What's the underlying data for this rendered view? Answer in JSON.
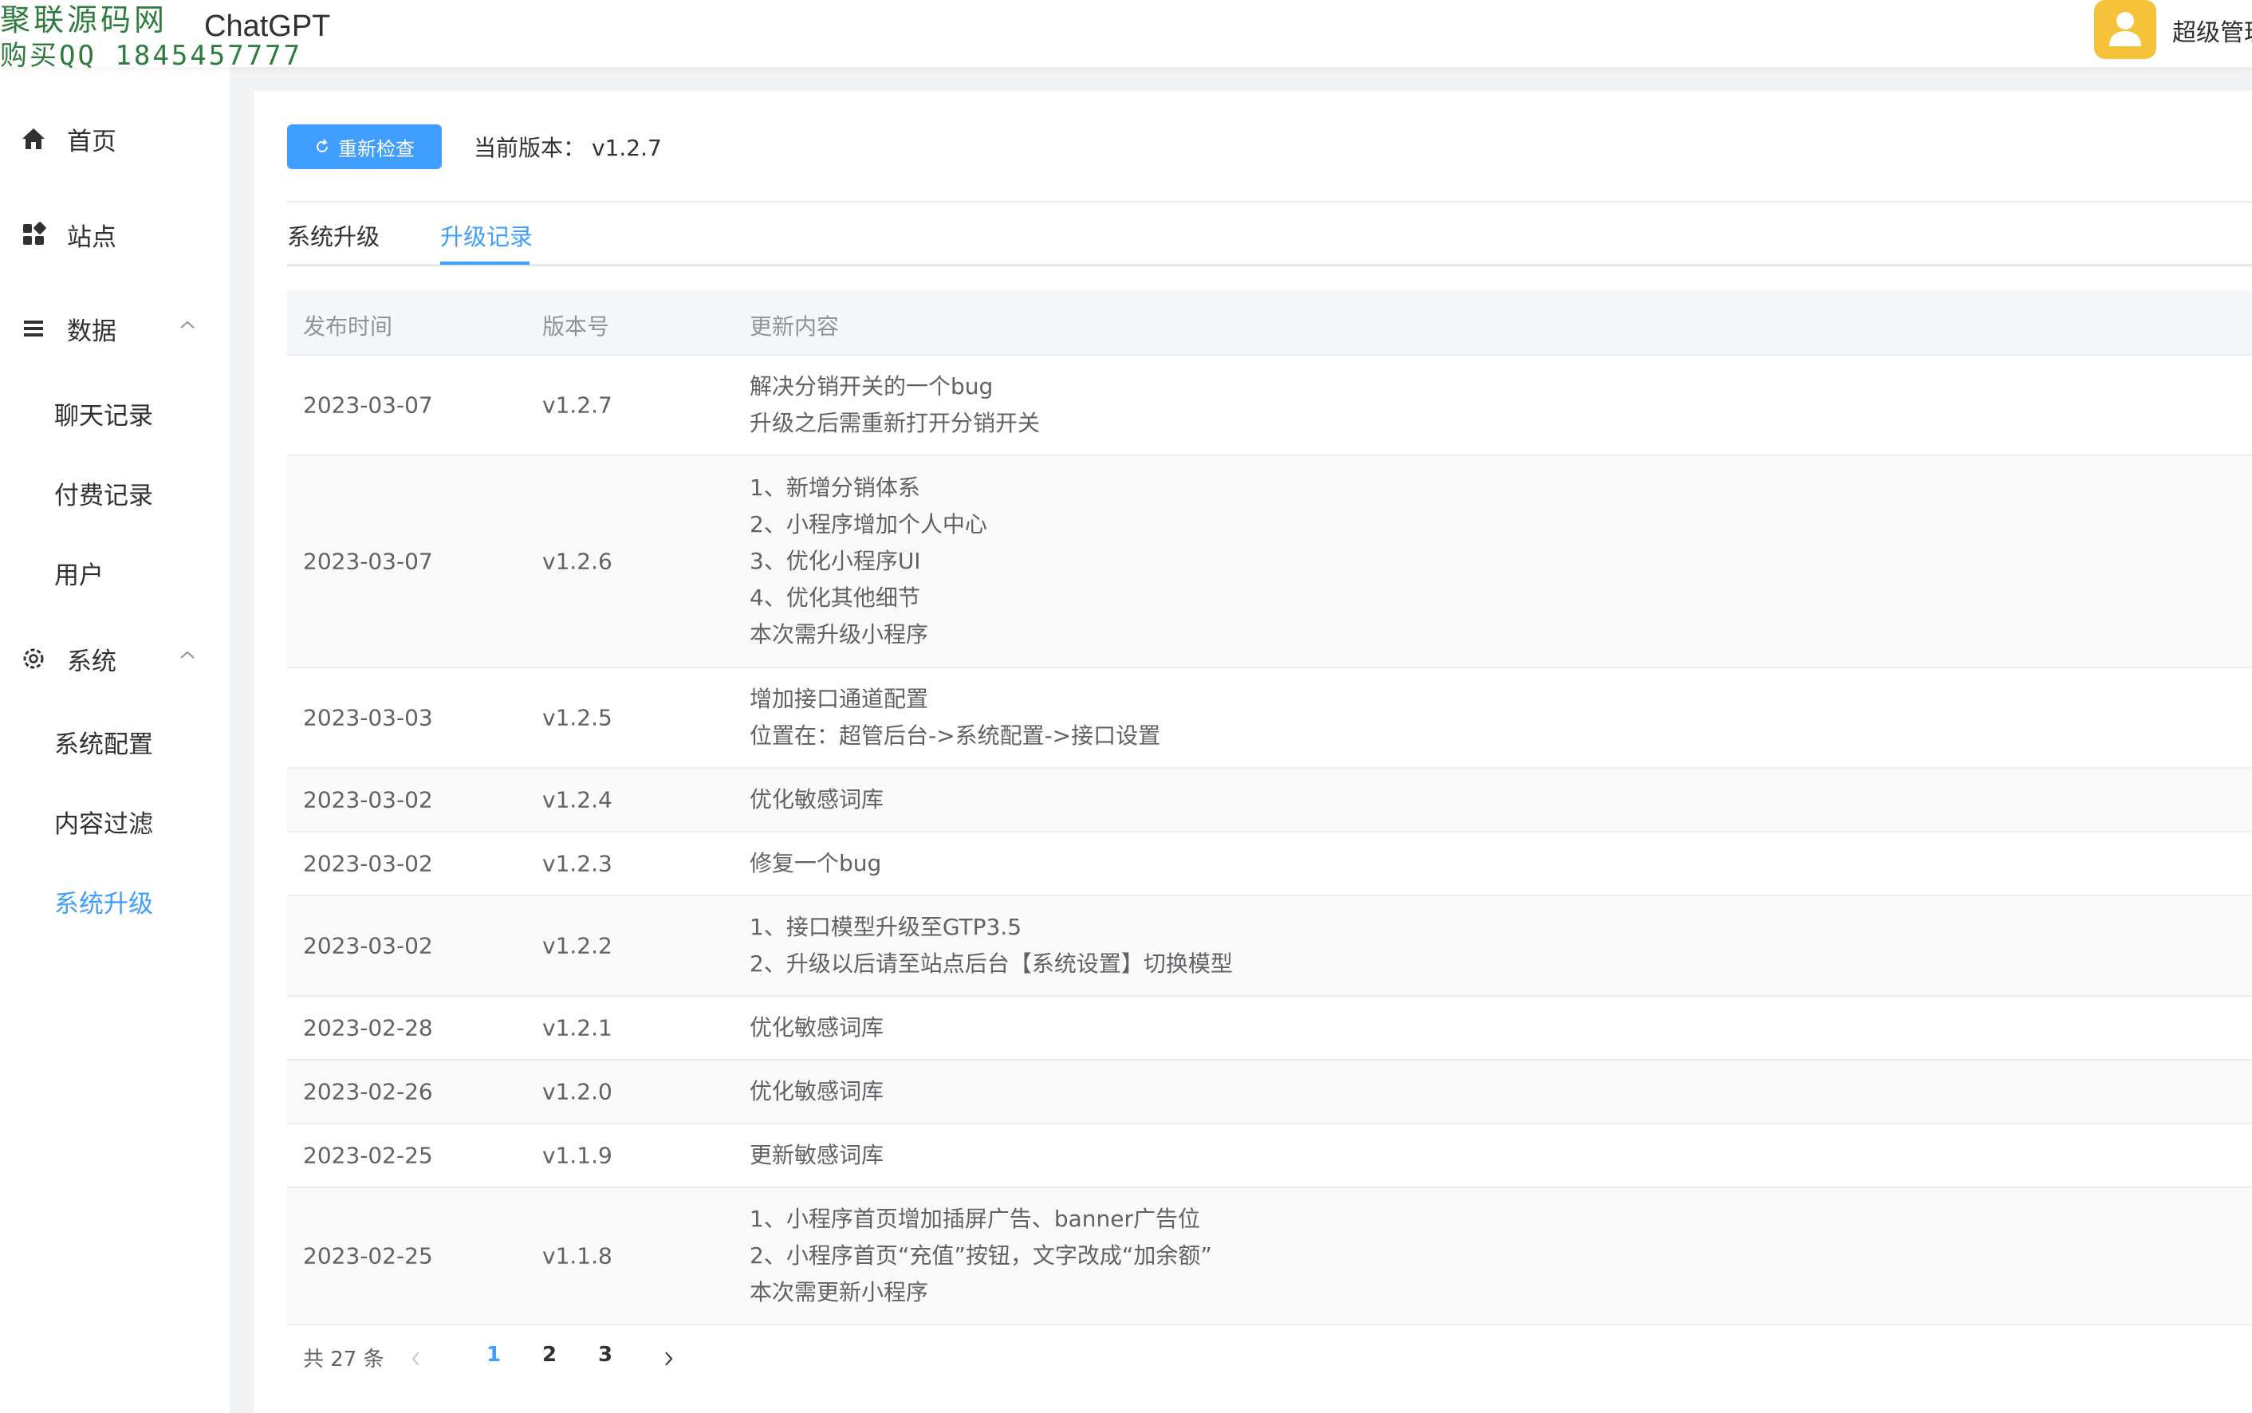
{
  "watermark": {
    "line1": "聚联源码网",
    "line2": "购买QQ 1845457777"
  },
  "header": {
    "app_title": "ChatGPT",
    "admin_name": "超级管理"
  },
  "sidebar": {
    "items": [
      {
        "label": "首页",
        "icon": "home-icon"
      },
      {
        "label": "站点",
        "icon": "apps-icon"
      },
      {
        "label": "数据",
        "icon": "menu-list-icon",
        "expanded": true,
        "children": [
          "聊天记录",
          "付费记录",
          "用户"
        ]
      },
      {
        "label": "系统",
        "icon": "gear-icon",
        "expanded": true,
        "children": [
          "系统配置",
          "内容过滤",
          "系统升级"
        ]
      }
    ],
    "active": "系统升级"
  },
  "toolbar": {
    "recheck_label": "重新检查",
    "current_version_label": "当前版本：",
    "current_version": "v1.2.7"
  },
  "tabs": [
    {
      "label": "系统升级",
      "active": false
    },
    {
      "label": "升级记录",
      "active": true
    }
  ],
  "table": {
    "columns": [
      "发布时间",
      "版本号",
      "更新内容"
    ],
    "rows": [
      {
        "date": "2023-03-07",
        "version": "v1.2.7",
        "content": [
          "解决分销开关的一个bug",
          "升级之后需重新打开分销开关"
        ]
      },
      {
        "date": "2023-03-07",
        "version": "v1.2.6",
        "content": [
          "1、新增分销体系",
          "2、小程序增加个人中心",
          "3、优化小程序UI",
          "4、优化其他细节",
          "本次需升级小程序"
        ]
      },
      {
        "date": "2023-03-03",
        "version": "v1.2.5",
        "content": [
          "增加接口通道配置",
          "位置在：超管后台->系统配置->接口设置"
        ]
      },
      {
        "date": "2023-03-02",
        "version": "v1.2.4",
        "content": [
          "优化敏感词库"
        ]
      },
      {
        "date": "2023-03-02",
        "version": "v1.2.3",
        "content": [
          "修复一个bug"
        ]
      },
      {
        "date": "2023-03-02",
        "version": "v1.2.2",
        "content": [
          "1、接口模型升级至GTP3.5",
          "2、升级以后请至站点后台【系统设置】切换模型"
        ]
      },
      {
        "date": "2023-02-28",
        "version": "v1.2.1",
        "content": [
          "优化敏感词库"
        ]
      },
      {
        "date": "2023-02-26",
        "version": "v1.2.0",
        "content": [
          "优化敏感词库"
        ]
      },
      {
        "date": "2023-02-25",
        "version": "v1.1.9",
        "content": [
          "更新敏感词库"
        ]
      },
      {
        "date": "2023-02-25",
        "version": "v1.1.8",
        "content": [
          "1、小程序首页增加插屏广告、banner广告位",
          "2、小程序首页“充值”按钮，文字改成“加余额”",
          "本次需更新小程序"
        ]
      }
    ]
  },
  "pagination": {
    "total_text": "共 27 条",
    "pages": [
      "1",
      "2",
      "3"
    ],
    "current": "1"
  },
  "colors": {
    "accent": "#409eff",
    "avatar": "#f6c23a",
    "watermark": "#2f7d3e"
  }
}
